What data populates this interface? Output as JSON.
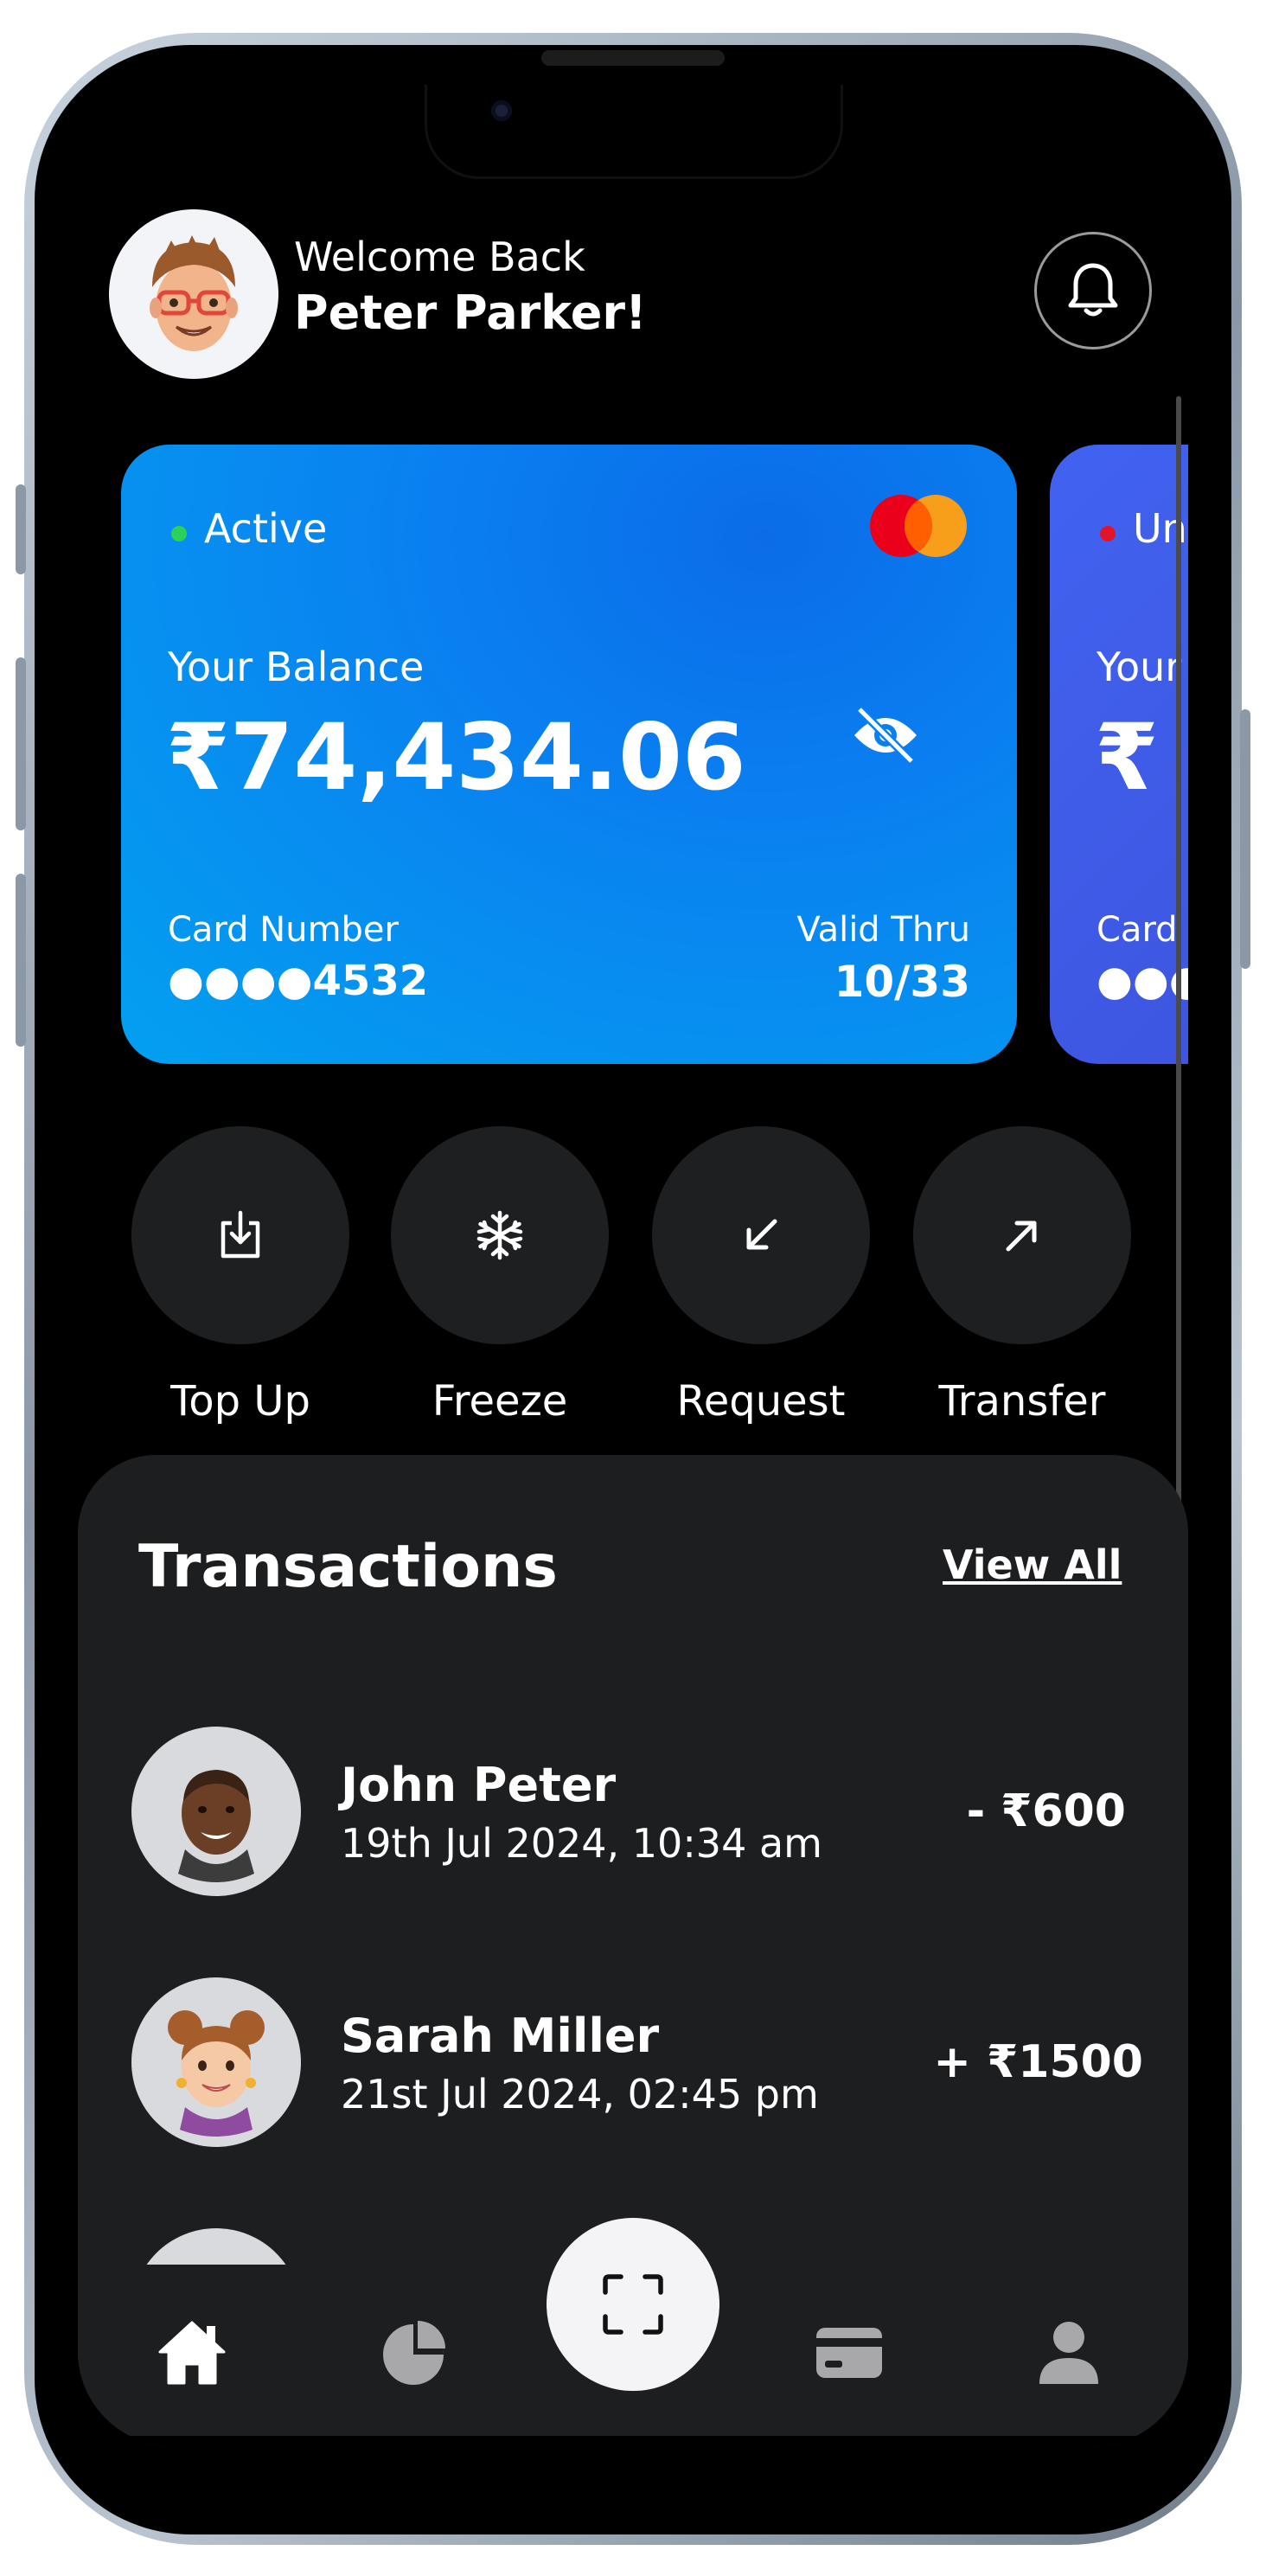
{
  "header": {
    "welcome": "Welcome Back",
    "username": "Peter Parker!"
  },
  "cards": [
    {
      "status": "Active",
      "status_color": "#2ed158",
      "balance_label": "Your Balance",
      "balance": "₹74,434.06",
      "card_number_label": "Card Number",
      "card_number": "●●●●4532",
      "valid_thru_label": "Valid Thru",
      "valid_thru": "10/33",
      "network": "mastercard"
    },
    {
      "status": "Un",
      "status_color": "#e0142b",
      "balance_label": "Your",
      "balance": "₹",
      "card_number_label": "Card",
      "card_number": "●●●"
    }
  ],
  "actions": [
    {
      "label": "Top Up",
      "icon": "download-icon"
    },
    {
      "label": "Freeze",
      "icon": "snowflake-icon"
    },
    {
      "label": "Request",
      "icon": "arrow-down-left-icon"
    },
    {
      "label": "Transfer",
      "icon": "arrow-up-right-icon"
    }
  ],
  "transactions": {
    "title": "Transactions",
    "view_all": "View All",
    "items": [
      {
        "name": "John Peter",
        "date": "19th Jul 2024, 10:34 am",
        "amount": "- ₹600"
      },
      {
        "name": "Sarah Miller",
        "date": "21st Jul 2024, 02:45 pm",
        "amount": "+ ₹1500"
      }
    ]
  },
  "nav": [
    "home-icon",
    "pie-chart-icon",
    "scan-icon",
    "card-icon",
    "profile-icon"
  ],
  "colors": {
    "background": "#000000",
    "panel": "#1d1e20",
    "card_blue": "#0a7ff0",
    "card_indigo": "#4163f0"
  }
}
